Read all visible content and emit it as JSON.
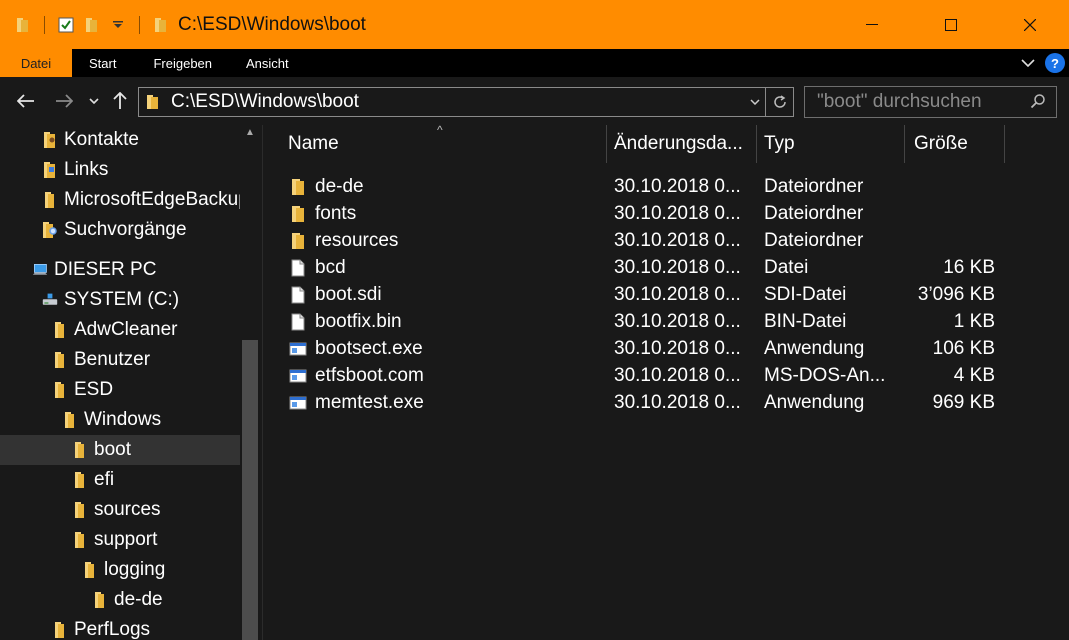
{
  "window": {
    "title": "C:\\ESD\\Windows\\boot",
    "minimize_glyph": "—",
    "maximize_glyph": "☐",
    "close_glyph": "✕"
  },
  "ribbon": {
    "tabs": [
      "Datei",
      "Start",
      "Freigeben",
      "Ansicht"
    ],
    "active_tab": "Datei",
    "help_label": "?"
  },
  "address": {
    "path": "C:\\ESD\\Windows\\boot",
    "search_placeholder": "\"boot\" durchsuchen"
  },
  "tree": [
    {
      "label": "Kontakte",
      "icon": "contacts-icon",
      "level": 1
    },
    {
      "label": "Links",
      "icon": "links-folder-icon",
      "level": 1
    },
    {
      "label": "MicrosoftEdgeBackups",
      "icon": "folder-icon",
      "level": 1
    },
    {
      "label": "Suchvorgänge",
      "icon": "search-folder-icon",
      "level": 1
    },
    {
      "label": "DIESER PC",
      "icon": "computer-icon",
      "level": 0
    },
    {
      "label": "SYSTEM (C:)",
      "icon": "drive-icon",
      "level": 1
    },
    {
      "label": "AdwCleaner",
      "icon": "folder-icon",
      "level": 2
    },
    {
      "label": "Benutzer",
      "icon": "folder-icon",
      "level": 2
    },
    {
      "label": "ESD",
      "icon": "folder-icon",
      "level": 2
    },
    {
      "label": "Windows",
      "icon": "folder-icon",
      "level": 3
    },
    {
      "label": "boot",
      "icon": "folder-icon",
      "level": 4,
      "selected": true
    },
    {
      "label": "efi",
      "icon": "folder-icon",
      "level": 4
    },
    {
      "label": "sources",
      "icon": "folder-icon",
      "level": 4
    },
    {
      "label": "support",
      "icon": "folder-icon",
      "level": 4
    },
    {
      "label": "logging",
      "icon": "folder-icon",
      "level": 5
    },
    {
      "label": "de-de",
      "icon": "folder-icon",
      "level": 6
    },
    {
      "label": "PerfLogs",
      "icon": "folder-icon",
      "level": 2
    }
  ],
  "columns": {
    "name": "Name",
    "date": "Änderungsda...",
    "type": "Typ",
    "size": "Größe"
  },
  "files": [
    {
      "name": "de-de",
      "date": "30.10.2018 0...",
      "type": "Dateiordner",
      "size": "",
      "icon": "folder-icon"
    },
    {
      "name": "fonts",
      "date": "30.10.2018 0...",
      "type": "Dateiordner",
      "size": "",
      "icon": "folder-icon"
    },
    {
      "name": "resources",
      "date": "30.10.2018 0...",
      "type": "Dateiordner",
      "size": "",
      "icon": "folder-icon"
    },
    {
      "name": "bcd",
      "date": "30.10.2018 0...",
      "type": "Datei",
      "size": "16 KB",
      "icon": "file-icon"
    },
    {
      "name": "boot.sdi",
      "date": "30.10.2018 0...",
      "type": "SDI-Datei",
      "size": "3’096 KB",
      "icon": "file-icon"
    },
    {
      "name": "bootfix.bin",
      "date": "30.10.2018 0...",
      "type": "BIN-Datei",
      "size": "1 KB",
      "icon": "file-icon"
    },
    {
      "name": "bootsect.exe",
      "date": "30.10.2018 0...",
      "type": "Anwendung",
      "size": "106 KB",
      "icon": "app-icon"
    },
    {
      "name": "etfsboot.com",
      "date": "30.10.2018 0...",
      "type": "MS-DOS-An...",
      "size": "4 KB",
      "icon": "app-icon"
    },
    {
      "name": "memtest.exe",
      "date": "30.10.2018 0...",
      "type": "Anwendung",
      "size": "969 KB",
      "icon": "app-icon"
    }
  ],
  "colors": {
    "accent": "#ff8c00",
    "background": "#191919",
    "folder": "#f5c242",
    "selected": "#333333"
  }
}
